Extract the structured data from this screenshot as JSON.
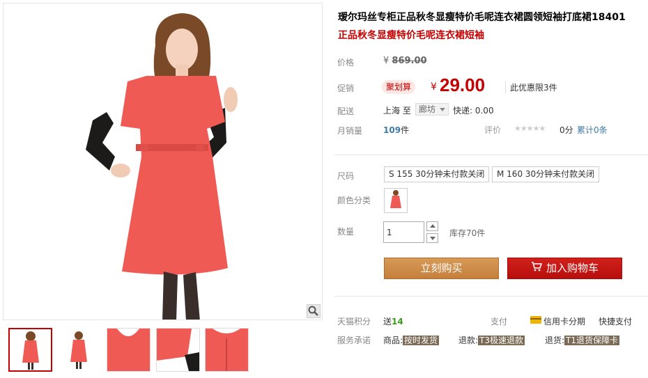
{
  "product": {
    "title": "瑷尔玛丝专柜正品秋冬显瘦特价毛呢连衣裙圆领短袖打底裙18401",
    "subtitle": "正品秋冬显瘦特价毛呢连衣裙短袖"
  },
  "price": {
    "label": "价格",
    "currency": "¥",
    "original": "869.00"
  },
  "promo": {
    "label": "促销",
    "badge": "聚划算",
    "currency": "¥",
    "price": "29.00",
    "limit": "此优惠限3件"
  },
  "shipping": {
    "label": "配送",
    "from": "上海 至",
    "to": "廊坊",
    "fee": "快递: 0.00"
  },
  "sales": {
    "label": "月销量",
    "count": "109",
    "unit": "件",
    "rating_label": "评价",
    "stars": "★★★★★",
    "rating_value": "0分",
    "reviews": "累计0条"
  },
  "options": {
    "size_label": "尺码",
    "sizes": [
      "S 155 30分钟未付款关闭",
      "M 160 30分钟未付款关闭"
    ],
    "color_label": "颜色分类"
  },
  "quantity": {
    "label": "数量",
    "value": "1",
    "stock": "库存70件"
  },
  "actions": {
    "buy_now": "立刻购买",
    "add_to_cart": "加入购物车"
  },
  "extra": {
    "points_label": "天猫积分",
    "points_prefix": "送",
    "points_value": "14",
    "pay_label": "支付",
    "credit_card": "信用卡分期",
    "quick_pay": "快捷支付",
    "service_label": "服务承诺",
    "service_items": [
      {
        "prefix": "商品:",
        "tag": "按时发货"
      },
      {
        "prefix": "退款:",
        "tag": "T3极速退款"
      },
      {
        "prefix": "退货:",
        "tag": "T1退货保障卡"
      }
    ]
  },
  "colors": {
    "accent": "#c40000",
    "dress": "#ef5a55",
    "buy_button": "#c98744",
    "cart_button": "#c11a16"
  },
  "icons": {
    "zoom": "magnifier-icon",
    "cart": "cart-icon",
    "card": "credit-card-icon"
  }
}
